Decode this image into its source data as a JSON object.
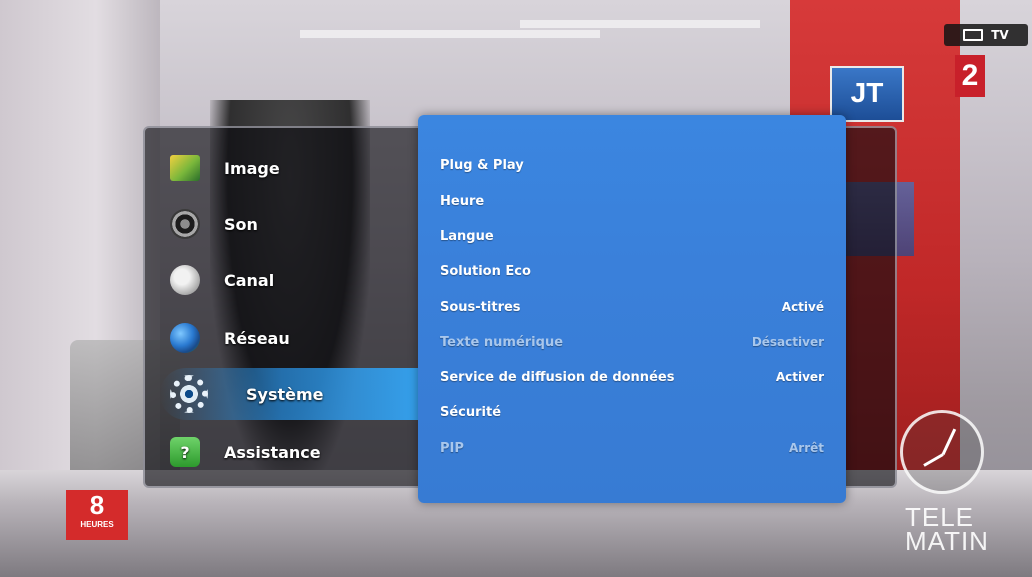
{
  "source": {
    "label": "TV"
  },
  "broadcast": {
    "channel_number": "2",
    "jt_label": "JT",
    "show_logo_number": "8",
    "show_logo_label": "HEURES",
    "program_logo_line1": "TELE",
    "program_logo_line2": "MATIN"
  },
  "menu": {
    "categories": [
      {
        "label": "Image",
        "icon": "image-icon"
      },
      {
        "label": "Son",
        "icon": "speaker-icon"
      },
      {
        "label": "Canal",
        "icon": "satellite-dish-icon"
      },
      {
        "label": "Réseau",
        "icon": "globe-icon"
      },
      {
        "label": "Système",
        "icon": "gear-icon"
      },
      {
        "label": "Assistance",
        "icon": "help-icon"
      }
    ],
    "selected_category": "Système",
    "submenu": [
      {
        "label": "Plug & Play",
        "value": "",
        "enabled": true
      },
      {
        "label": "Heure",
        "value": "",
        "enabled": true
      },
      {
        "label": "Langue",
        "value": "",
        "enabled": true
      },
      {
        "label": "Solution Eco",
        "value": "",
        "enabled": true
      },
      {
        "label": "Sous-titres",
        "value": "Activé",
        "enabled": true
      },
      {
        "label": "Texte numérique",
        "value": "Désactiver",
        "enabled": false
      },
      {
        "label": "Service de diffusion de données",
        "value": "Activer",
        "enabled": true
      },
      {
        "label": "Sécurité",
        "value": "",
        "enabled": true
      },
      {
        "label": "PIP",
        "value": "Arrêt",
        "enabled": false
      }
    ]
  },
  "colors": {
    "submenu_bg": "#3a80da",
    "selected_highlight": "#35a3f0",
    "disabled_text": "#a9c7ec"
  }
}
